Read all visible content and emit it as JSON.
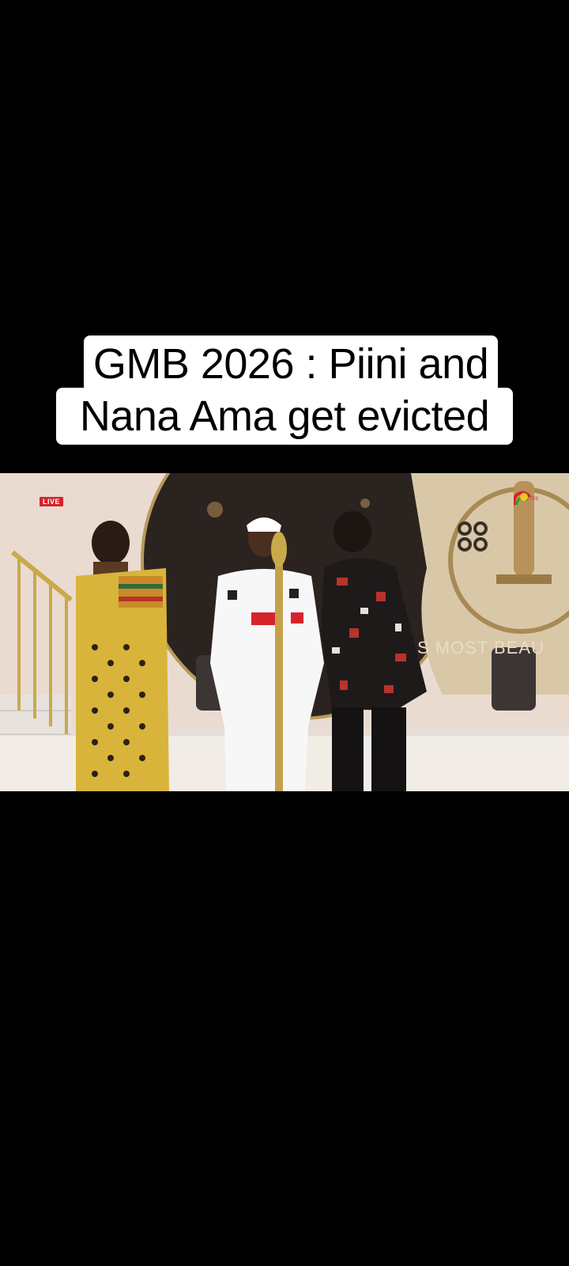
{
  "caption": {
    "line1": "GMB 2026 : Piini and",
    "line2": "Nana Ama get evicted"
  },
  "video": {
    "live_label": "LIVE",
    "stage_text": "S MOST BEAU",
    "channel_logo_icon": "tv3-logo-icon"
  },
  "colors": {
    "background": "#000000",
    "caption_bg": "#ffffff",
    "caption_text": "#000000",
    "live_red": "#d6232a"
  }
}
